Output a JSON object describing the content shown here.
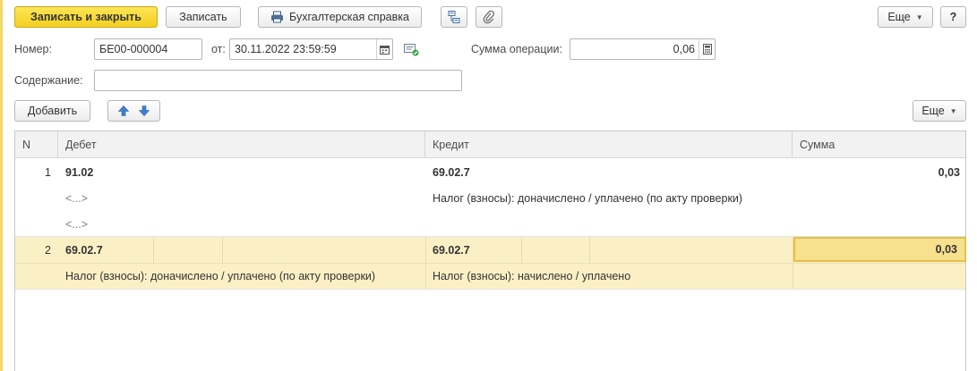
{
  "toolbar": {
    "save_close_label": "Записать и закрыть",
    "save_label": "Записать",
    "report_label": "Бухгалтерская справка",
    "more_label": "Еще",
    "help_label": "?"
  },
  "form": {
    "number_label": "Номер:",
    "number_value": "БЕ00-000004",
    "date_label": "от:",
    "date_value": "30.11.2022 23:59:59",
    "amount_label": "Сумма операции:",
    "amount_value": "0,06",
    "content_label": "Содержание:",
    "content_value": ""
  },
  "table_toolbar": {
    "add_label": "Добавить",
    "more_label": "Еще"
  },
  "table": {
    "columns": {
      "n": "N",
      "debit": "Дебет",
      "credit": "Кредит",
      "sum": "Сумма"
    },
    "rows": [
      {
        "n": "1",
        "debit": "91.02",
        "debit_sub1": "<...>",
        "debit_sub2": "<...>",
        "credit": "69.02.7",
        "credit_sub1": "Налог (взносы): доначислено / уплачено (по акту проверки)",
        "sum": "0,03"
      },
      {
        "n": "2",
        "debit": "69.02.7",
        "debit_sub1": "Налог (взносы): доначислено / уплачено (по акту проверки)",
        "credit": "69.02.7",
        "credit_sub1": "Налог (взносы): начислено / уплачено",
        "sum": "0,03"
      }
    ]
  },
  "colors": {
    "primary_button": "#f3cf1e",
    "selected_row": "#fbf0c5",
    "selected_cell_border": "#e5c04a"
  },
  "icons": [
    "printer-icon",
    "document-structure-icon",
    "paperclip-icon",
    "calendar-icon",
    "calculator-icon",
    "arrow-up-icon",
    "arrow-down-icon",
    "post-document-icon"
  ]
}
